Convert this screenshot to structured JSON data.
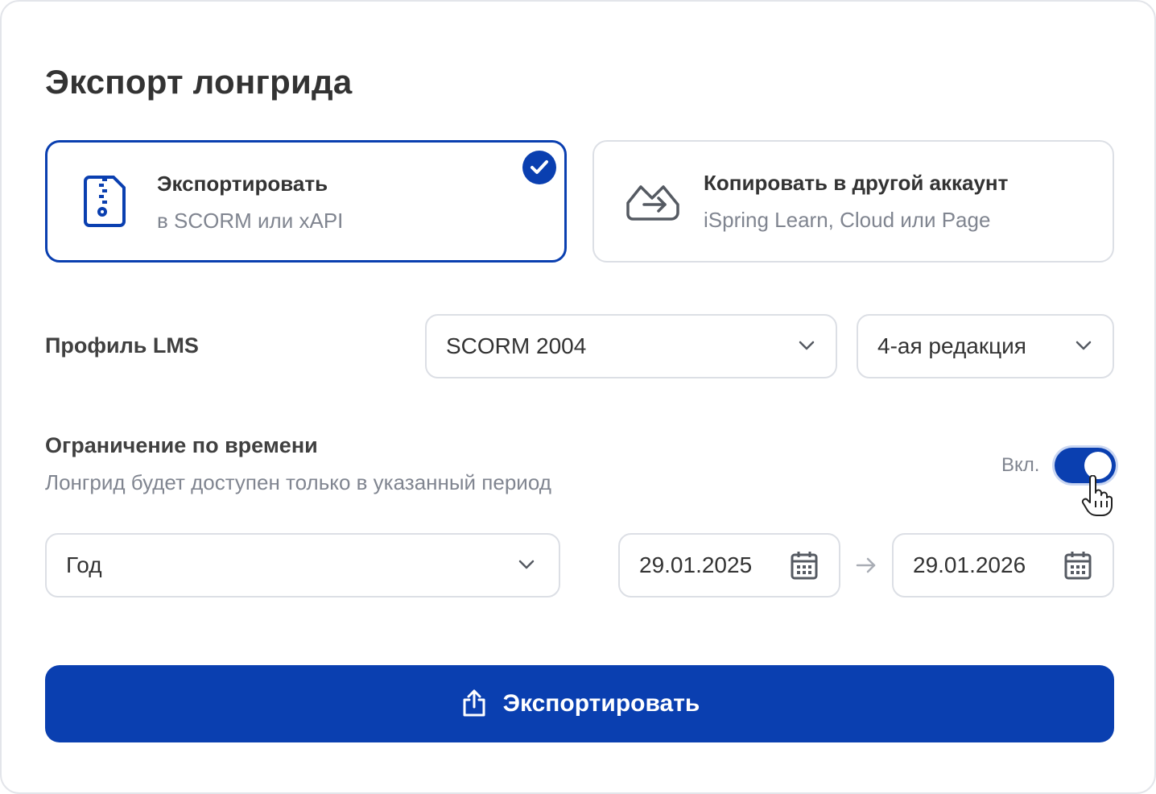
{
  "dialog": {
    "title": "Экспорт лонгрида"
  },
  "options": {
    "export": {
      "title": "Экспортировать",
      "subtitle": "в SCORM или xAPI",
      "icon": "zip-file-icon",
      "selected": true
    },
    "copy": {
      "title": "Копировать в другой аккаунт",
      "subtitle": "iSpring Learn, Cloud или Page",
      "icon": "share-export-icon",
      "selected": false
    }
  },
  "lms": {
    "label": "Профиль LMS",
    "profile": "SCORM 2004",
    "edition": "4-ая редакция"
  },
  "time_limit": {
    "title": "Ограничение по времени",
    "subtitle": "Лонгрид будет доступен только в указанный период",
    "toggle_label": "Вкл.",
    "enabled": true,
    "period": "Год",
    "date_from": "29.01.2025",
    "date_to": "29.01.2026"
  },
  "submit": {
    "label": "Экспортировать",
    "icon": "upload-icon"
  },
  "colors": {
    "accent": "#0a3fb0",
    "border": "#dcdfe5",
    "muted_text": "#808590"
  }
}
